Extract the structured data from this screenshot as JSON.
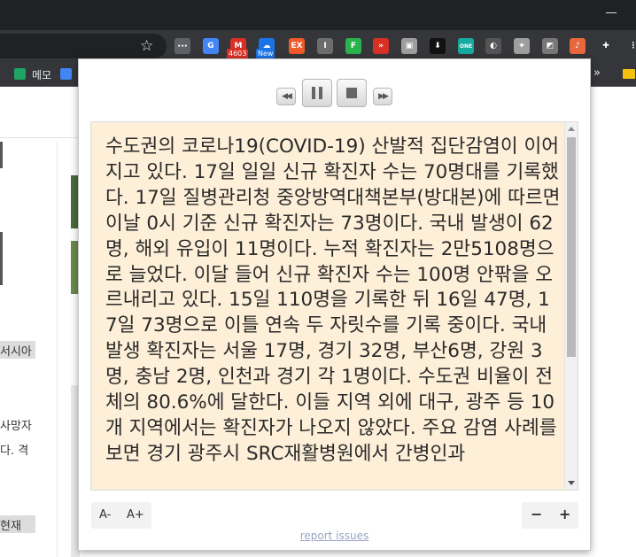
{
  "browser": {
    "star_icon": "☆",
    "extensions": [
      {
        "name": "more-dots-extension-icon",
        "color": "#5f6368",
        "glyph": "•••"
      },
      {
        "name": "translate-extension-icon",
        "color": "#4285f4",
        "glyph": "G"
      },
      {
        "name": "gmail-checker-extension-icon",
        "color": "#d93025",
        "glyph": "M"
      },
      {
        "name": "weather-extension-icon",
        "color": "#1a73e8",
        "glyph": "☁"
      },
      {
        "name": "ex-extension-icon",
        "color": "#f05a28",
        "glyph": "EX"
      },
      {
        "name": "reader-i-extension-icon",
        "color": "#6d6d6d",
        "glyph": "I"
      },
      {
        "name": "feedly-extension-icon",
        "color": "#2bb24c",
        "glyph": "F"
      },
      {
        "name": "fast-forward-extension-icon",
        "color": "#d93025",
        "glyph": "»"
      },
      {
        "name": "print-extension-icon",
        "color": "#9e9e9e",
        "glyph": "▣"
      },
      {
        "name": "download-extension-icon",
        "color": "#111111",
        "glyph": "⬇"
      },
      {
        "name": "one-extension-icon",
        "color": "#16a9a0",
        "glyph": "ONE"
      },
      {
        "name": "colorpick-extension-icon",
        "color": "#555555",
        "glyph": "◐"
      },
      {
        "name": "screenshot-extension-icon",
        "color": "#9e9e9e",
        "glyph": "⌖"
      },
      {
        "name": "note-extension-icon",
        "color": "#777777",
        "glyph": "◩"
      },
      {
        "name": "read-aloud-extension-icon",
        "color": "#e8673c",
        "glyph": "♪"
      },
      {
        "name": "puzzle-extensions-icon",
        "color": "#35363a",
        "glyph": "✚"
      },
      {
        "name": "menu-kebab-icon",
        "color": "#35363a",
        "glyph": "⋮"
      }
    ],
    "badges": {
      "gmail": "4603",
      "weather": "New"
    },
    "bookmarks": {
      "memo": "메모",
      "more": "»"
    }
  },
  "background_page": {
    "fragments": [
      "서시아",
      "사망자",
      "다. 격",
      "현재"
    ]
  },
  "reader": {
    "controls": {
      "rewind_glyph": "◀◀",
      "forward_glyph": "▶▶"
    },
    "text": "수도권의 코로나19(COVID-19) 산발적 집단감염이 이어지고 있다. 17일 일일 신규 확진자 수는 70명대를 기록했다. 17일 질병관리청 중앙방역대책본부(방대본)에 따르면 이날 0시 기준 신규 확진자는 73명이다. 국내 발생이 62명, 해외 유입이 11명이다. 누적 확진자는 2만5108명으로 늘었다. 이달 들어 신규 확진자 수는 100명 안팎을 오르내리고 있다. 15일 110명을 기록한 뒤 16일 47명, 17일 73명으로 이틀 연속 두 자릿수를 기록 중이다. 국내 발생 확진자는 서울 17명, 경기 32명, 부산6명, 강원 3명, 충남 2명, 인천과 경기 각 1명이다. 수도권 비율이 전체의 80.6%에 달한다. 이들 지역 외에 대구, 광주 등 10개 지역에서는 확진자가 나오지 않았다. 주요 감염 사례를 보면 경기 광주시 SRC재활병원에서 간병인과",
    "font_smaller": "A-",
    "font_larger": "A+",
    "zoom_out": "−",
    "zoom_in": "+",
    "report_link": "report issues"
  }
}
